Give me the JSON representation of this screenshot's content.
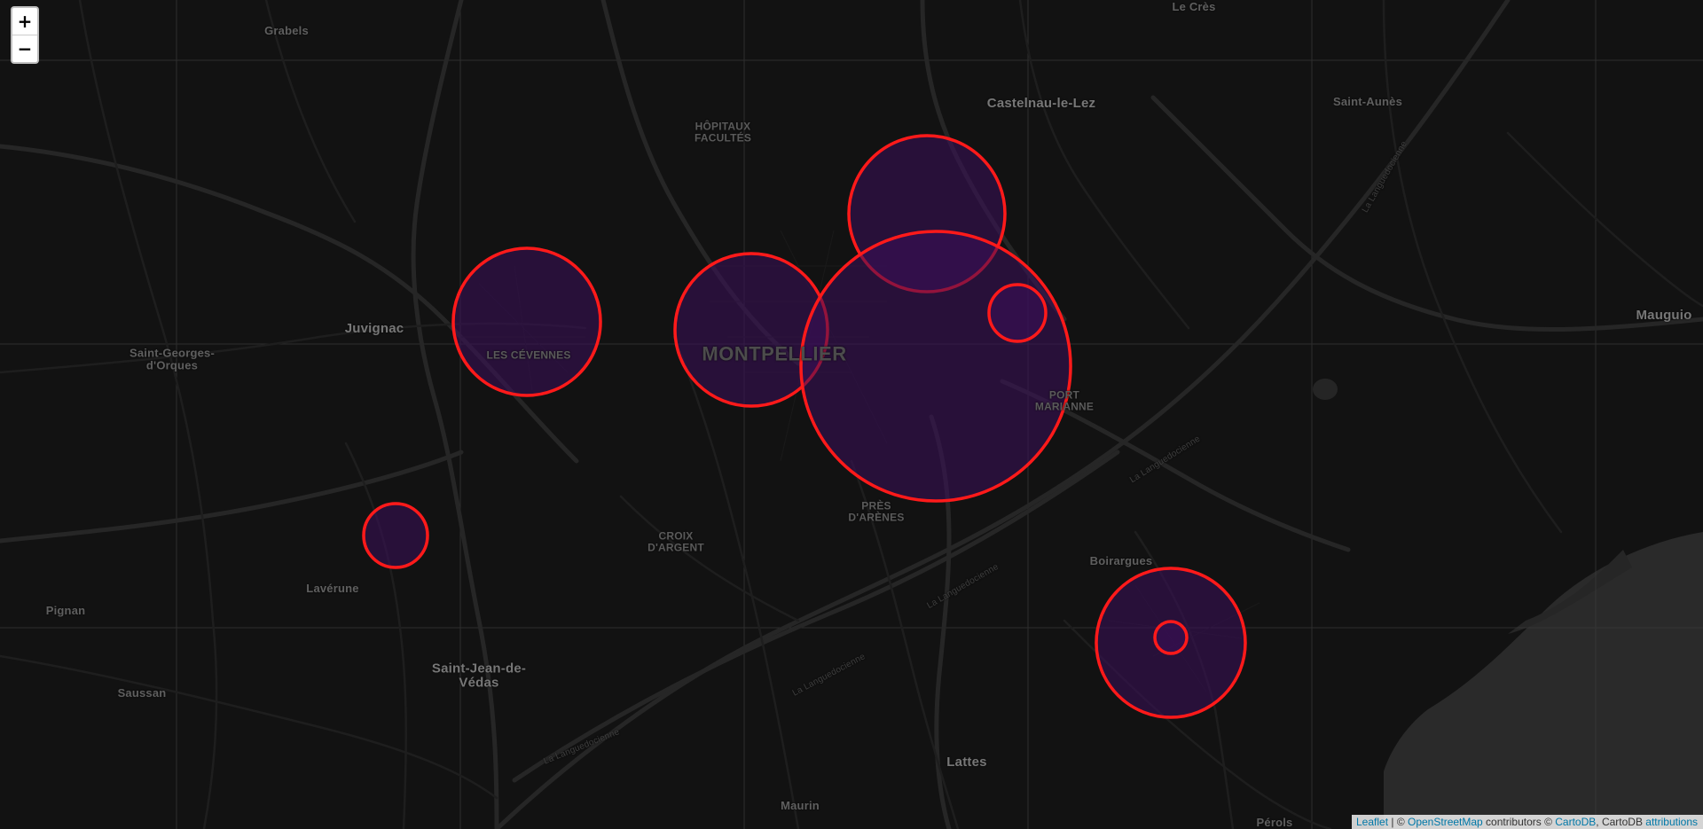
{
  "map": {
    "background": "#121212",
    "marker_stroke": "#ff1a1a",
    "marker_fill": "#3a0f5a",
    "water_color": "#2a2a2a"
  },
  "controls": {
    "zoom_in": "+",
    "zoom_out": "−"
  },
  "places": [
    {
      "name": "Le Crès"
    },
    {
      "name": "Grabels"
    },
    {
      "name": "Castelnau-le-Lez"
    },
    {
      "name": "Saint-Aunès"
    },
    {
      "name": "HÔPITAUX\nFACULTÉS"
    },
    {
      "name": "Juvignac"
    },
    {
      "name": "Saint-Georges-\nd'Orques"
    },
    {
      "name": "LES CÉVENNES"
    },
    {
      "name": "MONTPELLIER"
    },
    {
      "name": "PORT\nMARIANNE"
    },
    {
      "name": "Mauguio"
    },
    {
      "name": "PRÈS\nD'ARÈNES"
    },
    {
      "name": "CROIX\nD'ARGENT"
    },
    {
      "name": "Boirargues"
    },
    {
      "name": "Lavérune"
    },
    {
      "name": "Pignan"
    },
    {
      "name": "Saint-Jean-de-\nVédas"
    },
    {
      "name": "Saussan"
    },
    {
      "name": "Lattes"
    },
    {
      "name": "Maurin"
    },
    {
      "name": "Pérols"
    },
    {
      "name": "La Languedocienne"
    },
    {
      "name": "La Languedocienne"
    },
    {
      "name": "La Languedocienne"
    },
    {
      "name": "La Languedocienne"
    },
    {
      "name": "La Languedocienne"
    }
  ],
  "attribution": {
    "leaflet": "Leaflet",
    "sep": " | © ",
    "osm": "OpenStreetMap",
    "contrib": " contributors © ",
    "cartodb": "CartoDB",
    "middle": ", CartoDB ",
    "attributions": "attributions"
  }
}
